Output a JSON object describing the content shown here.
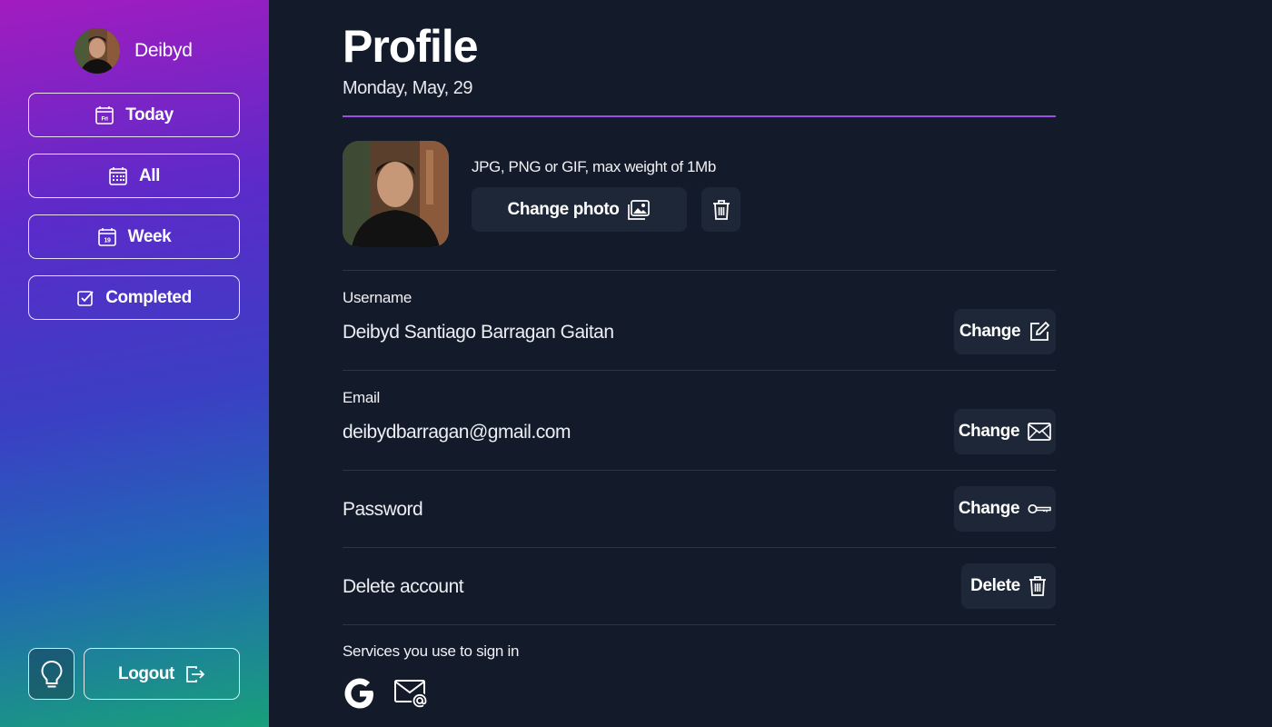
{
  "sidebar": {
    "user": {
      "name": "Deibyd"
    },
    "nav": [
      {
        "label": "Today",
        "icon": "calendar-day-icon",
        "icon_text": "Fri"
      },
      {
        "label": "All",
        "icon": "calendar-grid-icon"
      },
      {
        "label": "Week",
        "icon": "calendar-week-icon",
        "icon_text": "19"
      },
      {
        "label": "Completed",
        "icon": "checkbox-icon"
      }
    ],
    "theme_toggle": {
      "icon": "lightbulb-icon"
    },
    "logout": {
      "label": "Logout",
      "icon": "logout-icon"
    }
  },
  "header": {
    "title": "Profile",
    "date": "Monday, May, 29"
  },
  "photo": {
    "hint": "JPG, PNG or GIF, max weight of 1Mb",
    "change_label": "Change photo",
    "change_icon": "image-icon",
    "delete_icon": "trash-icon"
  },
  "fields": {
    "username": {
      "label": "Username",
      "value": "Deibyd Santiago Barragan Gaitan",
      "button": "Change",
      "icon": "edit-icon"
    },
    "email": {
      "label": "Email",
      "value": "deibydbarragan@gmail.com",
      "button": "Change",
      "icon": "envelope-icon"
    },
    "password": {
      "label": "Password",
      "button": "Change",
      "icon": "key-icon"
    },
    "delete": {
      "label": "Delete account",
      "button": "Delete",
      "icon": "trash-icon"
    }
  },
  "services": {
    "label": "Services you use to sign in",
    "items": [
      "google-icon",
      "email-at-icon"
    ]
  },
  "colors": {
    "background": "#131a2a",
    "button": "#1e2737",
    "accent_line": "#9b4fe0",
    "divider": "#2c3446"
  }
}
